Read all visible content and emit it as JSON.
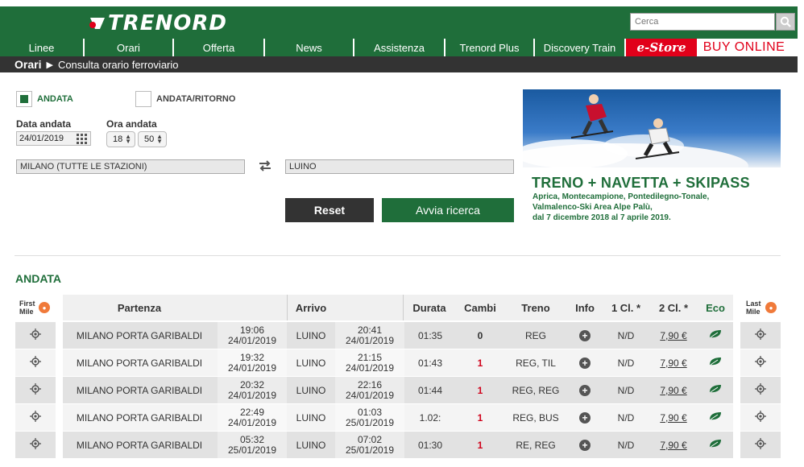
{
  "header": {
    "logo_text": "TRENORD",
    "search_placeholder": "Cerca"
  },
  "nav": [
    {
      "label": "Linee"
    },
    {
      "label": "Orari"
    },
    {
      "label": "Offerta"
    },
    {
      "label": "News"
    },
    {
      "label": "Assistenza"
    },
    {
      "label": "Trenord Plus"
    },
    {
      "label": "Discovery Train"
    },
    {
      "label": "e-Store"
    },
    {
      "label": "BUY ONLINE"
    }
  ],
  "breadcrumb": {
    "main": "Orari",
    "sub": "Consulta orario ferroviario"
  },
  "form": {
    "andata_label": "ANDATA",
    "andata_ritorno_label": "ANDATA/RITORNO",
    "data_label": "Data andata",
    "ora_label": "Ora andata",
    "date_value": "24/01/2019",
    "hour_value": "18",
    "minute_value": "50",
    "from_station": "MILANO (TUTTE LE STAZIONI)",
    "to_station": "LUINO",
    "reset_label": "Reset",
    "search_label": "Avvia ricerca"
  },
  "promo": {
    "title": "TRENO + NAVETTA + SKIPASS",
    "lines": [
      "Aprica, Montecampione, Pontedilegno-Tonale,",
      "Valmalenco-Ski Area Alpe Palù,",
      "dal 7 dicembre 2018 al 7 aprile 2019."
    ]
  },
  "results": {
    "section_title": "ANDATA",
    "headers": {
      "first_mile": "First Mile",
      "partenza": "Partenza",
      "arrivo": "Arrivo",
      "durata": "Durata",
      "cambi": "Cambi",
      "treno": "Treno",
      "info": "Info",
      "prima": "1 Cl. *",
      "seconda": "2 Cl. *",
      "eco": "Eco",
      "last_mile": "Last Mile"
    },
    "rows": [
      {
        "from": "MILANO PORTA GARIBALDI",
        "dep_time": "19:06",
        "dep_date": "24/01/2019",
        "to": "LUINO",
        "arr_time": "20:41",
        "arr_date": "24/01/2019",
        "durata": "01:35",
        "cambi": "0",
        "treno": "REG",
        "prima": "N/D",
        "seconda": "7,90 €"
      },
      {
        "from": "MILANO PORTA GARIBALDI",
        "dep_time": "19:32",
        "dep_date": "24/01/2019",
        "to": "LUINO",
        "arr_time": "21:15",
        "arr_date": "24/01/2019",
        "durata": "01:43",
        "cambi": "1",
        "treno": "REG, TIL",
        "prima": "N/D",
        "seconda": "7,90 €"
      },
      {
        "from": "MILANO PORTA GARIBALDI",
        "dep_time": "20:32",
        "dep_date": "24/01/2019",
        "to": "LUINO",
        "arr_time": "22:16",
        "arr_date": "24/01/2019",
        "durata": "01:44",
        "cambi": "1",
        "treno": "REG, REG",
        "prima": "N/D",
        "seconda": "7,90 €"
      },
      {
        "from": "MILANO PORTA GARIBALDI",
        "dep_time": "22:49",
        "dep_date": "24/01/2019",
        "to": "LUINO",
        "arr_time": "01:03",
        "arr_date": "25/01/2019",
        "durata": "1.02:",
        "cambi": "1",
        "treno": "REG, BUS",
        "prima": "N/D",
        "seconda": "7,90 €"
      },
      {
        "from": "MILANO PORTA GARIBALDI",
        "dep_time": "05:32",
        "dep_date": "25/01/2019",
        "to": "LUINO",
        "arr_time": "07:02",
        "arr_date": "25/01/2019",
        "durata": "01:30",
        "cambi": "1",
        "treno": "RE, REG",
        "prima": "N/D",
        "seconda": "7,90 €"
      }
    ]
  },
  "colors": {
    "brand_green": "#1f6e3a",
    "estore_red": "#e1001a",
    "mile_orange": "#f07a3a",
    "cambi_red": "#d0021b"
  }
}
